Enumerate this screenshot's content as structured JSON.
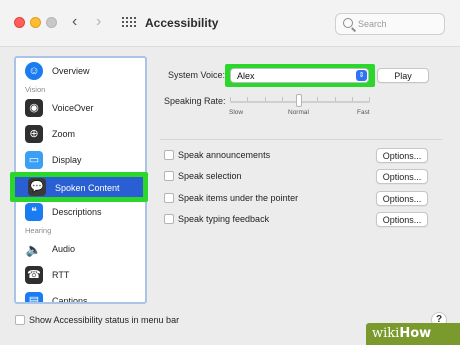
{
  "window": {
    "title": "Accessibility"
  },
  "search": {
    "placeholder": "Search"
  },
  "sidebar": {
    "items": [
      {
        "label": "Overview",
        "icon": "accessibility-icon"
      },
      {
        "section": "Vision"
      },
      {
        "label": "VoiceOver",
        "icon": "voiceover-icon"
      },
      {
        "label": "Zoom",
        "icon": "zoom-icon"
      },
      {
        "label": "Display",
        "icon": "display-icon"
      },
      {
        "label": "Spoken Content",
        "icon": "speech-bubble-icon",
        "selected": true
      },
      {
        "label": "Descriptions",
        "icon": "descriptions-icon"
      },
      {
        "section": "Hearing"
      },
      {
        "label": "Audio",
        "icon": "speaker-icon"
      },
      {
        "label": "RTT",
        "icon": "rtt-icon"
      },
      {
        "label": "Captions",
        "icon": "captions-icon"
      }
    ]
  },
  "spoken_content": {
    "system_voice_label": "System Voice:",
    "system_voice_value": "Alex",
    "play_label": "Play",
    "speaking_rate_label": "Speaking Rate:",
    "rate_ticks": {
      "slow": "Slow",
      "normal": "Normal",
      "fast": "Fast"
    },
    "speaking_rate_position": 0.5,
    "options": [
      {
        "label": "Speak announcements",
        "checked": false,
        "button": "Options..."
      },
      {
        "label": "Speak selection",
        "checked": false,
        "button": "Options..."
      },
      {
        "label": "Speak items under the pointer",
        "checked": false,
        "button": "Options..."
      },
      {
        "label": "Speak typing feedback",
        "checked": false,
        "button": "Options..."
      }
    ]
  },
  "footer": {
    "status_checkbox_label": "Show Accessibility status in menu bar",
    "help_label": "?"
  },
  "watermark": {
    "prefix": "wiki",
    "suffix": "How"
  },
  "colors": {
    "selection_blue": "#2a5fd3",
    "highlight_green": "#2ad72a",
    "accent_blue": "#2f73f0"
  }
}
